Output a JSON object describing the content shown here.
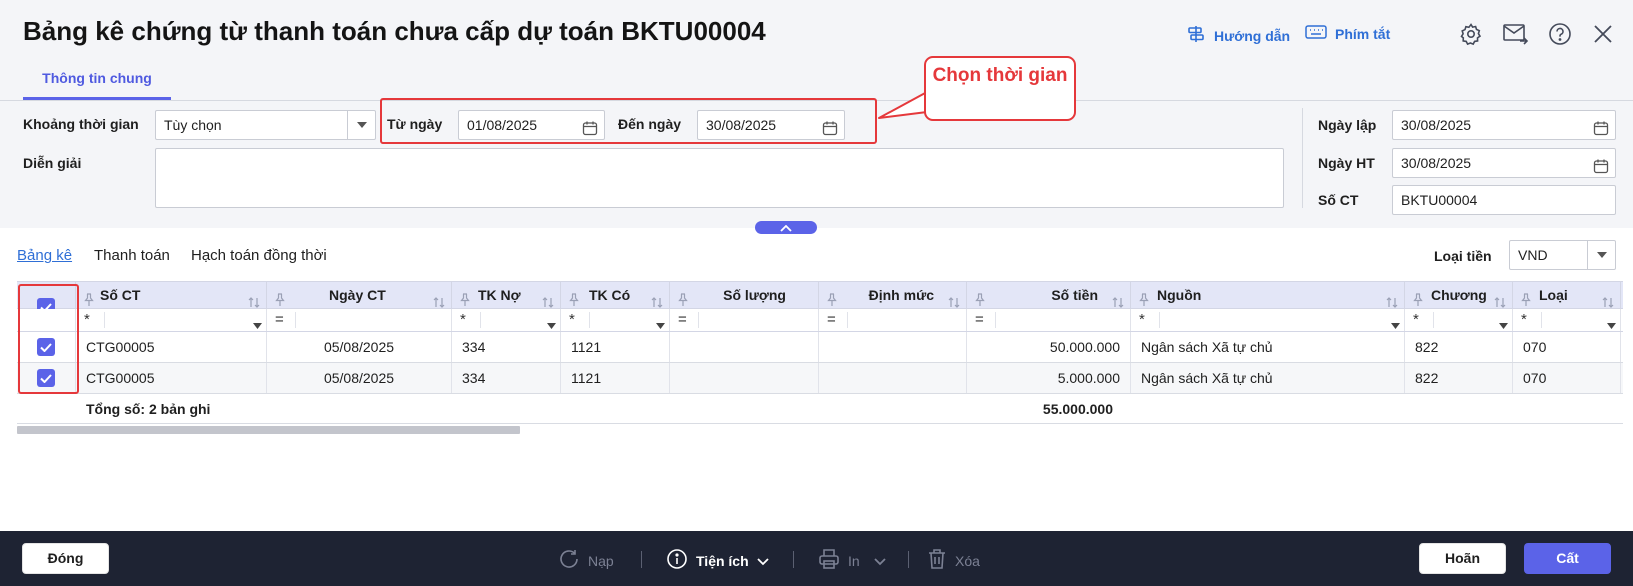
{
  "window": {
    "title": "Bảng kê chứng từ thanh toán chưa cấp dự toán BKTU00004",
    "help_label": "Hướng dẫn",
    "shortcuts_label": "Phím tắt"
  },
  "tabs": [
    "Thông tin chung"
  ],
  "form": {
    "period_label": "Khoảng thời gian",
    "period_value": "Tùy chọn",
    "from_label": "Từ ngày",
    "from_value": "01/08/2025",
    "to_label": "Đến ngày",
    "to_value": "30/08/2025",
    "desc_label": "Diễn giải",
    "desc_value": "",
    "created_label": "Ngày lập",
    "created_value": "30/08/2025",
    "posted_label": "Ngày HT",
    "posted_value": "30/08/2025",
    "docno_label": "Số CT",
    "docno_value": "BKTU00004"
  },
  "callout": {
    "text": "Chọn thời gian"
  },
  "subtabs": [
    "Bảng kê",
    "Thanh toán",
    "Hạch toán đồng thời"
  ],
  "currency": {
    "label": "Loại tiền",
    "value": "VND"
  },
  "grid": {
    "columns": [
      "Số CT",
      "Ngày CT",
      "TK Nợ",
      "TK Có",
      "Số lượng",
      "Định mức",
      "Số tiền",
      "Nguồn",
      "Chương",
      "Loại"
    ],
    "filter_ops": [
      "*",
      "=",
      "*",
      "*",
      "=",
      "=",
      "=",
      "*",
      "*",
      "*"
    ],
    "rows": [
      {
        "checked": true,
        "so_ct": "CTG00005",
        "ngay_ct": "05/08/2025",
        "tk_no": "334",
        "tk_co": "1121",
        "so_luong": "",
        "dinh_muc": "",
        "so_tien": "50.000.000",
        "nguon": "Ngân sách Xã tự chủ",
        "chuong": "822",
        "loai": "070"
      },
      {
        "checked": true,
        "so_ct": "CTG00005",
        "ngay_ct": "05/08/2025",
        "tk_no": "334",
        "tk_co": "1121",
        "so_luong": "",
        "dinh_muc": "",
        "so_tien": "5.000.000",
        "nguon": "Ngân sách Xã tự chủ",
        "chuong": "822",
        "loai": "070"
      }
    ],
    "total_label": "Tổng số: 2 bản ghi",
    "total_amount": "55.000.000"
  },
  "footer": {
    "close_label": "Đóng",
    "reload_label": "Nạp",
    "utilities_label": "Tiện ích",
    "print_label": "In",
    "delete_label": "Xóa",
    "undo_label": "Hoãn",
    "save_label": "Cất"
  },
  "colors": {
    "accent": "#5b63e8",
    "link": "#2f6fd6",
    "highlight": "#e5383b",
    "footer_bg": "#1e2333"
  }
}
